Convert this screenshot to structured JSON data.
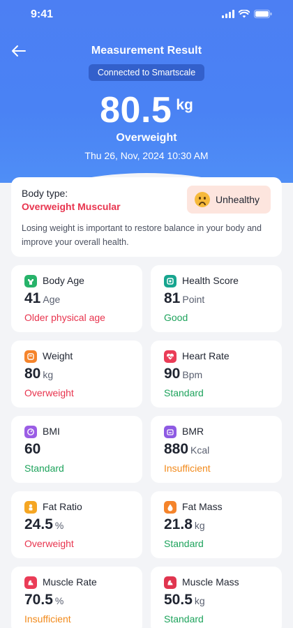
{
  "status_bar": {
    "time": "9:41"
  },
  "header": {
    "title": "Measurement Result",
    "connected": "Connected to Smartscale",
    "weight_value": "80.5",
    "weight_unit": "kg",
    "weight_status": "Overweight",
    "date": "Thu 26, Nov, 2024 10:30 AM"
  },
  "body_type": {
    "label": "Body type:",
    "value": "Overweight Muscular",
    "badge": "Unhealthy",
    "description": "Losing weight is important to restore balance in your body and improve your overall health."
  },
  "metrics": [
    {
      "label": "Body Age",
      "value": "41",
      "unit": "Age",
      "status": "Older physical age",
      "status_color": "red",
      "icon": "body-age-icon",
      "icon_color": "#27b36a"
    },
    {
      "label": "Health Score",
      "value": "81",
      "unit": "Point",
      "status": "Good",
      "status_color": "green",
      "icon": "health-score-icon",
      "icon_color": "#17a58f"
    },
    {
      "label": "Weight",
      "value": "80",
      "unit": "kg",
      "status": "Overweight",
      "status_color": "red",
      "icon": "weight-icon",
      "icon_color": "#f5842b"
    },
    {
      "label": "Heart Rate",
      "value": "90",
      "unit": "Bpm",
      "status": "Standard",
      "status_color": "green",
      "icon": "heart-rate-icon",
      "icon_color": "#ea3c57"
    },
    {
      "label": "BMI",
      "value": "60",
      "unit": "",
      "status": "Standard",
      "status_color": "green",
      "icon": "bmi-icon",
      "icon_color": "#9b5de5"
    },
    {
      "label": "BMR",
      "value": "880",
      "unit": "Kcal",
      "status": "Insufficient",
      "status_color": "orange",
      "icon": "bmr-icon",
      "icon_color": "#8e5ae3"
    },
    {
      "label": "Fat Ratio",
      "value": "24.5",
      "unit": "%",
      "status": "Overweight",
      "status_color": "red",
      "icon": "fat-ratio-icon",
      "icon_color": "#f5a623"
    },
    {
      "label": "Fat Mass",
      "value": "21.8",
      "unit": "kg",
      "status": "Standard",
      "status_color": "green",
      "icon": "fat-mass-icon",
      "icon_color": "#f5842b"
    },
    {
      "label": "Muscle Rate",
      "value": "70.5",
      "unit": "%",
      "status": "Insufficient",
      "status_color": "orange",
      "icon": "muscle-rate-icon",
      "icon_color": "#ea3c57"
    },
    {
      "label": "Muscle Mass",
      "value": "50.5",
      "unit": "kg",
      "status": "Standard",
      "status_color": "green",
      "icon": "muscle-mass-icon",
      "icon_color": "#e0354f"
    }
  ],
  "colors": {
    "header_blue": "#4c7ff3",
    "red": "#e8344e",
    "green": "#1ea35c",
    "orange": "#f28a1b",
    "badge_bg": "#fde5de"
  }
}
